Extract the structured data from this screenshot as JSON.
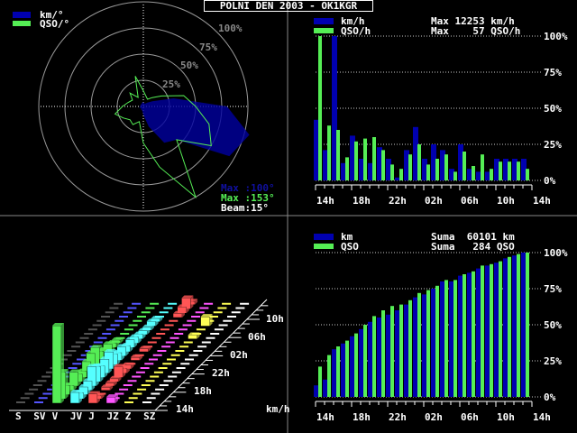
{
  "title": "POLNI DEN 2003 - OK1KGR",
  "colors": {
    "km": "#0000b0",
    "qso": "#55ee55",
    "grid": "#cccccc",
    "ring": "#888888"
  },
  "polar": {
    "legend": [
      {
        "label": "km/°"
      },
      {
        "label": "QSO/°"
      }
    ],
    "rings": [
      "25%",
      "50%",
      "75%",
      "100%"
    ],
    "info": {
      "km_max": "Max :100°",
      "qso_max": "Max :153°",
      "beam": "Beam:15°"
    },
    "chart_data": {
      "type": "polar",
      "bearings_deg": [
        0,
        15,
        30,
        45,
        60,
        75,
        90,
        105,
        120,
        135,
        150,
        165,
        180,
        195,
        210,
        225,
        240,
        255,
        270,
        285,
        300,
        315,
        330,
        345
      ],
      "qso_pct": [
        15,
        10,
        8,
        12,
        20,
        40,
        50,
        65,
        75,
        45,
        100,
        60,
        35,
        15,
        20,
        18,
        22,
        28,
        20,
        15,
        12,
        18,
        10,
        30
      ],
      "km_pct": [
        4,
        3,
        3,
        5,
        10,
        30,
        80,
        105,
        95,
        45,
        40,
        20,
        8,
        4,
        4,
        3,
        3,
        4,
        3,
        3,
        3,
        3,
        3,
        4
      ]
    }
  },
  "hourly": {
    "legend": [
      {
        "label": "km/h",
        "max": "Max 12253 km/h"
      },
      {
        "label": "QSO/h",
        "max": "Max    57 QSO/h"
      }
    ],
    "chart_data": {
      "type": "bar",
      "x_labels": [
        "14h",
        "18h",
        "22h",
        "02h",
        "06h",
        "10h",
        "14h"
      ],
      "y_ticks": [
        "0%",
        "25%",
        "50%",
        "75%",
        "100%"
      ],
      "ylim": [
        0,
        100
      ],
      "series": [
        {
          "name": "km/h",
          "values": [
            42,
            21,
            100,
            12,
            31,
            15,
            12,
            23,
            15,
            2,
            21,
            37,
            15,
            25,
            21,
            8,
            25,
            8,
            6,
            6,
            15,
            15,
            15,
            15
          ]
        },
        {
          "name": "QSO/h",
          "values": [
            100,
            38,
            35,
            16,
            27,
            29,
            30,
            21,
            11,
            8,
            18,
            25,
            11,
            15,
            18,
            6,
            20,
            10,
            18,
            8,
            13,
            13,
            13,
            8
          ]
        }
      ]
    }
  },
  "cumulative": {
    "legend": [
      {
        "label": "km",
        "sum": "Suma  60101 km"
      },
      {
        "label": "QSO",
        "sum": "Suma   284 QSO"
      }
    ],
    "chart_data": {
      "type": "bar",
      "x_labels": [
        "14h",
        "18h",
        "22h",
        "02h",
        "06h",
        "10h",
        "14h"
      ],
      "y_ticks": [
        "0%",
        "25%",
        "50%",
        "75%",
        "100%"
      ],
      "ylim": [
        0,
        100
      ],
      "series": [
        {
          "name": "km",
          "values": [
            8,
            12,
            33,
            37,
            42,
            47,
            52,
            55,
            57,
            60,
            64,
            69,
            71,
            75,
            80,
            80,
            84,
            86,
            89,
            91,
            93,
            96,
            98,
            100
          ]
        },
        {
          "name": "QSO",
          "values": [
            21,
            29,
            35,
            39,
            44,
            50,
            56,
            60,
            63,
            64,
            67,
            72,
            74,
            77,
            81,
            81,
            85,
            87,
            91,
            92,
            94,
            97,
            99,
            100
          ]
        }
      ]
    }
  },
  "directional": {
    "directions": [
      "S",
      "SV",
      "V",
      "JV",
      "J",
      "JZ",
      "Z",
      "SZ"
    ],
    "dir_colors": [
      "#888888",
      "#5555ff",
      "#55ee55",
      "#55ffff",
      "#ff5555",
      "#ff55ff",
      "#ffff55",
      "#ffffff"
    ],
    "hour_labels": [
      "14h",
      "18h",
      "22h",
      "02h",
      "06h",
      "10h"
    ],
    "unit": "km/h",
    "chart_data": {
      "type": "bar3d",
      "heights_pct": [
        [
          0,
          0,
          0,
          0,
          0,
          0,
          0,
          0,
          0,
          0,
          0,
          0,
          0,
          0,
          0,
          0,
          0,
          0,
          0,
          0,
          0,
          0,
          0,
          0
        ],
        [
          0,
          0,
          0,
          0,
          0,
          0,
          0,
          0,
          0,
          0,
          0,
          2,
          0,
          0,
          0,
          0,
          0,
          0,
          0,
          0,
          0,
          0,
          0,
          0
        ],
        [
          100,
          35,
          12,
          6,
          18,
          10,
          8,
          15,
          20,
          22,
          12,
          8,
          10,
          6,
          4,
          3,
          2,
          2,
          2,
          2,
          2,
          2,
          2,
          2
        ],
        [
          14,
          8,
          10,
          12,
          25,
          20,
          15,
          18,
          22,
          14,
          10,
          12,
          8,
          10,
          8,
          6,
          5,
          4,
          6,
          4,
          3,
          3,
          2,
          2
        ],
        [
          12,
          4,
          3,
          4,
          4,
          4,
          14,
          6,
          5,
          3,
          4,
          3,
          4,
          3,
          2,
          3,
          3,
          2,
          2,
          3,
          5,
          8,
          14,
          4
        ],
        [
          8,
          2,
          2,
          3,
          3,
          2,
          2,
          2,
          2,
          2,
          2,
          2,
          2,
          2,
          2,
          2,
          2,
          2,
          2,
          2,
          2,
          2,
          2,
          2
        ],
        [
          0,
          0,
          0,
          0,
          0,
          0,
          0,
          0,
          0,
          0,
          0,
          0,
          0,
          0,
          0,
          5,
          2,
          2,
          12,
          2,
          2,
          2,
          0,
          0
        ],
        [
          0,
          0,
          0,
          0,
          0,
          0,
          0,
          0,
          0,
          0,
          0,
          0,
          0,
          0,
          0,
          0,
          0,
          0,
          0,
          0,
          0,
          0,
          0,
          0
        ]
      ]
    }
  }
}
